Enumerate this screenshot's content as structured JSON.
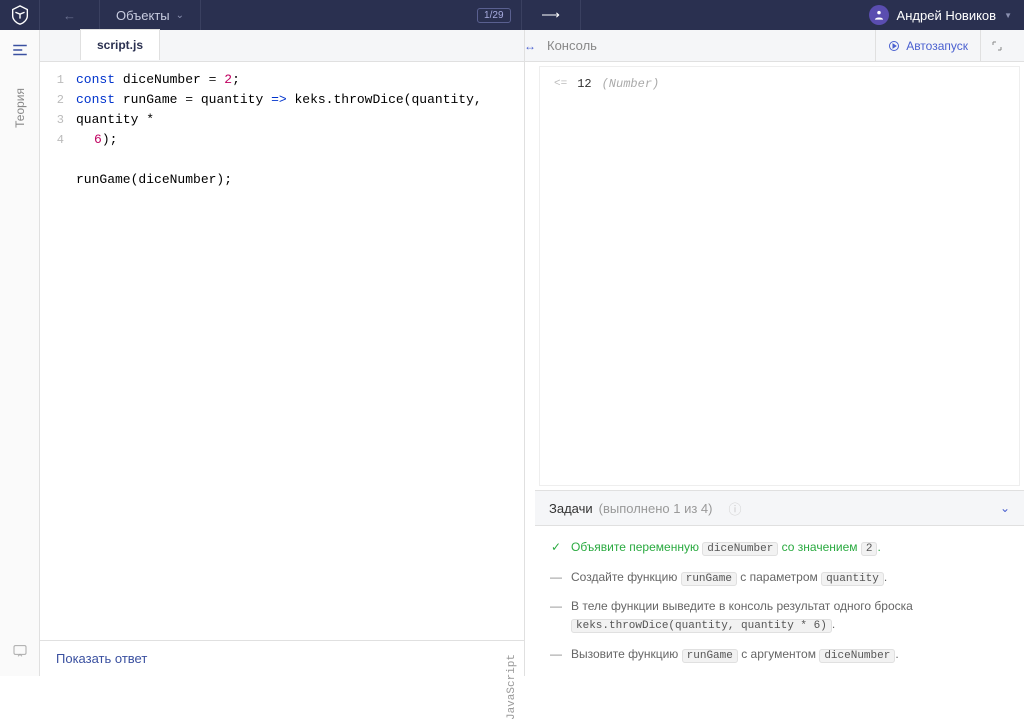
{
  "header": {
    "section_title": "Объекты",
    "progress": "1/29",
    "user_name": "Андрей Новиков"
  },
  "sidebar": {
    "theory_label": "Теория"
  },
  "editor": {
    "tab_name": "script.js",
    "language": "JavaScript",
    "lines": [
      "1",
      "2",
      "",
      "3",
      "4"
    ],
    "code": {
      "l1_kw1": "const",
      "l1_var": " diceNumber ",
      "l1_op": "= ",
      "l1_num": "2",
      "l1_end": ";",
      "l2_kw1": "const",
      "l2_var": " runGame ",
      "l2_op": "= ",
      "l2_arg": "quantity ",
      "l2_arrow": "=> ",
      "l2_call": "keks.throwDice(quantity, quantity * ",
      "l2b_num": "6",
      "l2b_end": ");",
      "l4_call": "runGame(diceNumber);"
    },
    "show_answer": "Показать ответ"
  },
  "console": {
    "title": "Консоль",
    "autorun": "Автозапуск",
    "output": {
      "value": "12",
      "type": "(Number)"
    }
  },
  "tasks": {
    "title": "Задачи",
    "progress": "(выполнено 1 из 4)",
    "items": [
      {
        "done": true,
        "pre": "Объявите переменную ",
        "code1": "diceNumber",
        "mid": " со значением ",
        "code2": "2",
        "post": "."
      },
      {
        "done": false,
        "pre": "Создайте функцию ",
        "code1": "runGame",
        "mid": " с параметром ",
        "code2": "quantity",
        "post": "."
      },
      {
        "done": false,
        "pre": "В теле функции выведите в консоль результат одного броска ",
        "code1": "keks.throwDice(quantity, quantity * 6)",
        "mid": "",
        "code2": "",
        "post": "."
      },
      {
        "done": false,
        "pre": "Вызовите функцию ",
        "code1": "runGame",
        "mid": " с аргументом ",
        "code2": "diceNumber",
        "post": "."
      }
    ]
  }
}
